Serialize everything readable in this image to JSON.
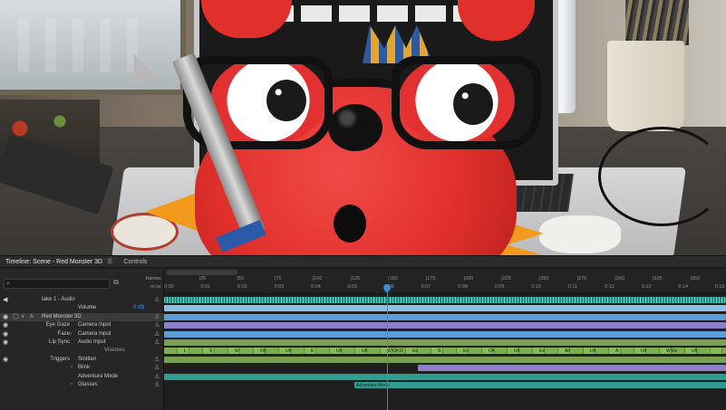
{
  "timeline": {
    "title": "Timeline: Scene - Red Monster 3D",
    "menu_icon": "hamburger-menu-icon",
    "controls_tab": "Controls",
    "search": {
      "value": "",
      "placeholder": ""
    },
    "ruler": {
      "frames_label": "frames",
      "mss_label": "m:ss",
      "frame_ticks": [
        "|25",
        "|50",
        "|75",
        "|100",
        "|125",
        "|150",
        "|175",
        "|200",
        "|225",
        "|250",
        "|275",
        "|300",
        "|325",
        "|350"
      ],
      "time_ticks": [
        "0:00",
        "0:01",
        "0:02",
        "0:03",
        "0:04",
        "0:05",
        "0:06",
        "0:07",
        "0:08",
        "0:09",
        "0:10",
        "0:11",
        "0:12",
        "0:13",
        "0:14",
        "0:15"
      ],
      "playhead_seconds": 6.0,
      "visible_seconds": 15.3
    },
    "rows": [
      {
        "c1": "",
        "c2": "take 1 - Audio",
        "vis": true,
        "arm": true
      },
      {
        "c1": "",
        "c2": "Volume",
        "value": "0 dB"
      },
      {
        "c1": "",
        "c2": "Red Monster 3D",
        "vis": true,
        "arm": true,
        "selected": true
      },
      {
        "c1": "Eye Gaze",
        "c2": "Camera Input",
        "vis": true,
        "arm": true
      },
      {
        "c1": "Face",
        "c2": "Camera Input",
        "vis": true,
        "arm": true,
        "chevron": true
      },
      {
        "c1": "Lip Sync",
        "c2": "Audio Input",
        "vis": true,
        "arm": true
      },
      {
        "c1": "",
        "c2": "Visemes"
      },
      {
        "c1": "Triggers",
        "c2": "Smitten",
        "vis": true,
        "arm": true
      },
      {
        "c1": "",
        "c2": "Blink",
        "chevron": true,
        "arm": true
      },
      {
        "c1": "",
        "c2": "Adventure Mode",
        "arm": true
      },
      {
        "c1": "",
        "c2": "Glasses",
        "chevron": true,
        "arm": true
      }
    ],
    "segment_labels": {
      "adventure": "Adventure Mode",
      "visemes": [
        "L",
        "S",
        "W",
        "Oh",
        "Uh",
        "E",
        "Uh",
        "Uh",
        "W Oh D",
        "Ee",
        "S",
        "Ee",
        "Oh",
        "Uh",
        "Ee",
        "Ah",
        "Uh",
        "A",
        "Uh",
        "W Ee",
        "Uh"
      ]
    },
    "colors": {
      "playhead": "#3a8bd6",
      "audio": "#1f8a7e",
      "visemes": "#7bae4e",
      "camera": "#5a9ed8",
      "trigger": "#8c7ec8"
    }
  }
}
